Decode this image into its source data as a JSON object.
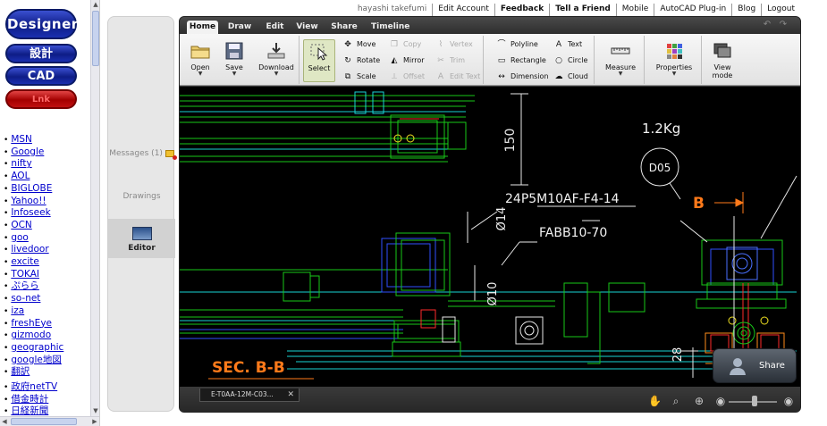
{
  "left_frame": {
    "pills": {
      "designer": "Designer",
      "sekkei": "設計",
      "cad": "CAD",
      "other": "Lnk"
    },
    "links": [
      "MSN",
      "Google",
      "nifty",
      "AOL",
      "BIGLOBE",
      "Yahoo!!",
      "Infoseek",
      "OCN",
      "goo",
      "livedoor",
      "excite",
      "TOKAI",
      "ぷらら",
      "so-net",
      "iza",
      "freshEye",
      "gizmodo",
      "geographic",
      "google地図",
      "翻訳"
    ],
    "links2": [
      "政府netTV",
      "借金時計",
      "日経新聞"
    ]
  },
  "topnav": {
    "user": "hayashi takefumi",
    "edit_account": "Edit Account",
    "feedback": "Feedback",
    "tell_friend": "Tell a Friend",
    "mobile": "Mobile",
    "plugin": "AutoCAD Plug-in",
    "blog": "Blog",
    "logout": "Logout"
  },
  "sidepanel": {
    "messages": "Messages (1)",
    "drawings": "Drawings",
    "editor": "Editor"
  },
  "tabs": {
    "home": "Home",
    "draw": "Draw",
    "edit": "Edit",
    "view": "View",
    "share": "Share",
    "timeline": "Timeline"
  },
  "ribbon": {
    "open": "Open",
    "save": "Save",
    "download": "Download",
    "select": "Select",
    "move": "Move",
    "rotate": "Rotate",
    "scale": "Scale",
    "copy": "Copy",
    "mirror": "Mirror",
    "offset": "Offset",
    "vertex": "Vertex",
    "trim": "Trim",
    "edit_text": "Edit Text",
    "polyline": "Polyline",
    "rectangle": "Rectangle",
    "dimension": "Dimension",
    "text": "Text",
    "circle": "Circle",
    "cloud": "Cloud",
    "measure": "Measure",
    "properties": "Properties",
    "view_mode": "View mode"
  },
  "drawing": {
    "dim_150": "150",
    "weight": "1.2Kg",
    "balloon": "D05",
    "part1": "24P5M10AF-F4-14",
    "part2": "FABB10-70",
    "dia14": "Ø14",
    "dia10": "Ø10",
    "section_b": "B",
    "dim_28": "28",
    "section_title": "SEC. B-B"
  },
  "bottom": {
    "file_tab": "E-T0AA-12M-C03...",
    "share": "Share"
  },
  "colors": {
    "canvas_bg": "#000000",
    "cad_green": "#18c818",
    "cad_cyan": "#19d4d4",
    "section_orange": "#ff7a1a",
    "pill_blue": "#0e1d86",
    "pill_red": "#a40000"
  }
}
